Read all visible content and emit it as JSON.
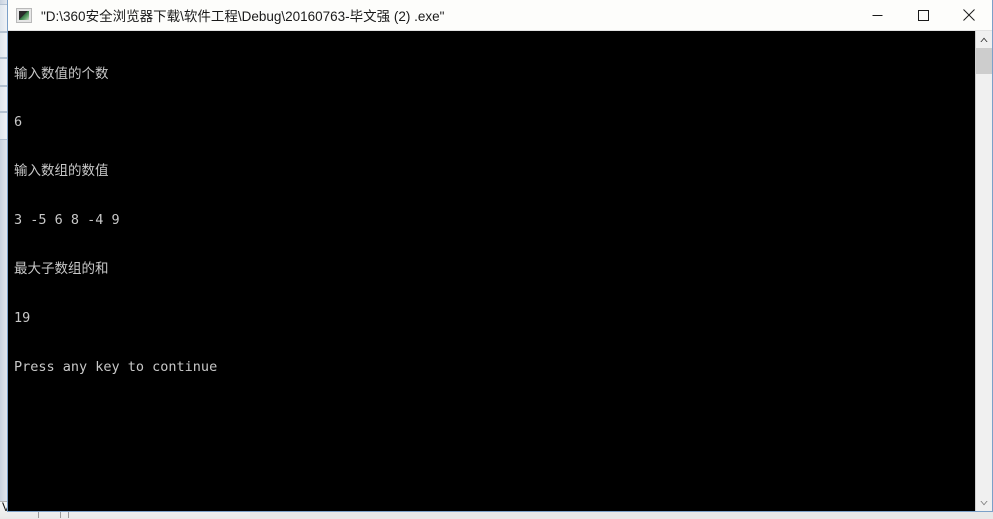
{
  "window": {
    "title": "\"D:\\360安全浏览器下载\\软件工程\\Debug\\20160763-毕文强 (2) .exe\"",
    "icon_name": "console-app-icon",
    "controls": {
      "minimize_label": "Minimize",
      "maximize_label": "Maximize",
      "close_label": "Close"
    }
  },
  "console": {
    "foreground_color": "#c8c8c8",
    "background_color": "#000000",
    "lines": [
      "输入数值的个数",
      "6",
      "输入数组的数值",
      "3 -5 6 8 -4 9",
      "最大子数组的和",
      "19",
      "Press any key to continue"
    ],
    "line_1": "输入数值的个数",
    "line_2": "6",
    "line_3": "输入数组的数值",
    "line_4": "3 -5 6 8 -4 9",
    "line_5": "最大子数组的和",
    "line_6": "19",
    "line_7": "Press any key to continue"
  },
  "scrollbar": {
    "up_arrow_name": "scroll-up-arrow",
    "down_arrow_name": "scroll-down-arrow"
  },
  "background_window": {
    "bottom_label": "View"
  }
}
